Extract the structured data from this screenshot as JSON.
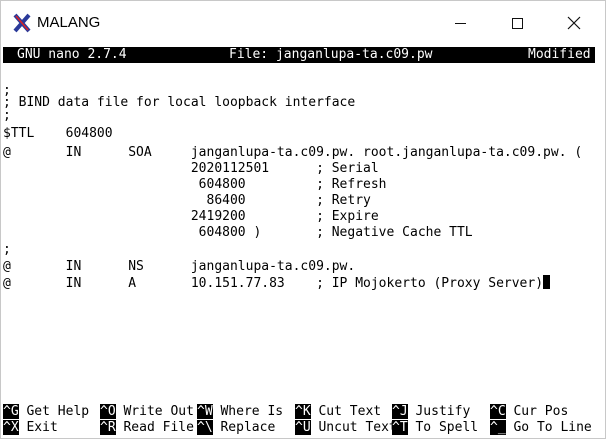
{
  "window": {
    "title": "MALANG",
    "minimize": "—",
    "maximize": "☐",
    "close": "✕"
  },
  "nano": {
    "version": "GNU nano 2.7.4",
    "file": "File: janganlupa-ta.c09.pw",
    "status": "Modified"
  },
  "editor_lines": [
    ";",
    "; BIND data file for local loopback interface",
    ";",
    "$TTL    604800",
    "@       IN      SOA     janganlupa-ta.c09.pw. root.janganlupa-ta.c09.pw. (",
    "                        2020112501      ; Serial",
    "                         604800         ; Refresh",
    "                          86400         ; Retry",
    "                        2419200         ; Expire",
    "                         604800 )       ; Negative Cache TTL",
    ";",
    "@       IN      NS      janganlupa-ta.c09.pw.",
    "@       IN      A       10.151.77.83    ; IP Mojokerto (Proxy Server)"
  ],
  "shortcuts": [
    {
      "key": "^G",
      "label": "Get Help"
    },
    {
      "key": "^O",
      "label": "Write Out"
    },
    {
      "key": "^W",
      "label": "Where Is"
    },
    {
      "key": "^K",
      "label": "Cut Text"
    },
    {
      "key": "^J",
      "label": "Justify"
    },
    {
      "key": "^C",
      "label": "Cur Pos"
    },
    {
      "key": "^X",
      "label": "Exit"
    },
    {
      "key": "^R",
      "label": "Read File"
    },
    {
      "key": "^\\",
      "label": "Replace"
    },
    {
      "key": "^U",
      "label": "Uncut Text"
    },
    {
      "key": "^T",
      "label": "To Spell"
    },
    {
      "key": "^_",
      "label": "Go To Line"
    }
  ]
}
